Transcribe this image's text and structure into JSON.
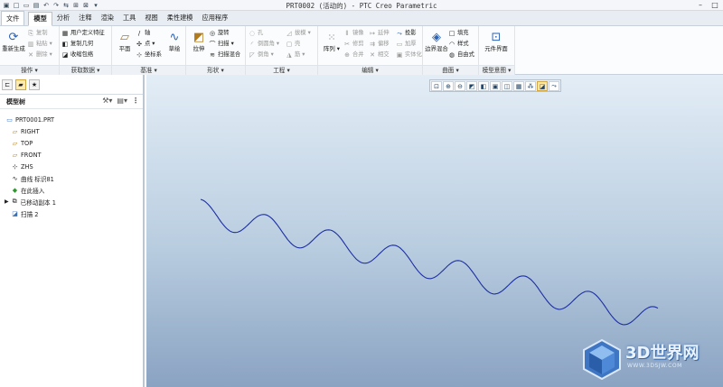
{
  "window": {
    "title": "PRT0002 (活动的) - PTC Creo Parametric"
  },
  "ribbon_tabs": [
    "文件",
    "模型",
    "分析",
    "注释",
    "渲染",
    "工具",
    "视图",
    "柔性建模",
    "应用程序"
  ],
  "ribbon": {
    "groups": [
      "操作",
      "获取数据",
      "基准",
      "形状",
      "工程",
      "编辑",
      "曲面",
      "模型意图"
    ],
    "regenerate": "重新生成",
    "copy": "复制",
    "paste": "粘贴",
    "delete": "删除",
    "udf": "用户定义特征",
    "copy_geom": "复制几何",
    "shrinkwrap": "收缩包络",
    "plane": "平面",
    "axis": "轴",
    "point": "点",
    "csys": "坐标系",
    "sketch": "草绘",
    "extrude": "拉伸",
    "revolve": "旋转",
    "sweep": "扫描",
    "swept_blend": "扫描混合",
    "hole": "孔",
    "round": "倒圆角",
    "chamfer": "倒角",
    "draft": "拔模",
    "shell": "壳",
    "rib": "筋",
    "pattern": "阵列",
    "mirror": "镜像",
    "trim": "修剪",
    "merge": "合并",
    "extend": "延伸",
    "offset": "偏移",
    "intersect": "相交",
    "project": "投影",
    "thicken": "加厚",
    "solidify": "实体化",
    "boundary_blend": "边界混合",
    "fill": "填充",
    "style": "样式",
    "freestyle": "自由式",
    "component_interface": "元件界面"
  },
  "panel": {
    "title": "模型树",
    "tree": [
      {
        "label": "PRT0001.PRT",
        "icon": "part-icon"
      },
      {
        "label": "RIGHT",
        "icon": "datum-plane-icon"
      },
      {
        "label": "TOP",
        "icon": "datum-plane-icon"
      },
      {
        "label": "FRONT",
        "icon": "datum-plane-icon"
      },
      {
        "label": "ZHS",
        "icon": "csys-icon"
      },
      {
        "label": "曲线 标识81",
        "icon": "curve-icon"
      },
      {
        "label": "在此插入",
        "icon": "insert-here-icon"
      },
      {
        "label": "已移动副本 1",
        "icon": "moved-copy-icon"
      },
      {
        "label": "扫描 2",
        "icon": "sweep-icon"
      }
    ]
  },
  "watermark": {
    "text": "3D世界网",
    "url": "WWW.3DSJW.COM"
  },
  "colors": {
    "curve": "#1d2fa3",
    "viewport_top": "#e3edf6",
    "viewport_bottom": "#8aa3c2",
    "active_tab": "#ffffff"
  }
}
